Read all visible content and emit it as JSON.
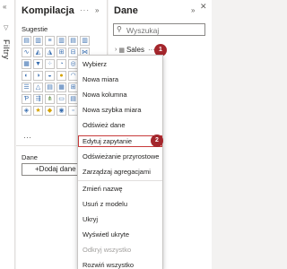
{
  "filters": {
    "label": "Filtry",
    "collapse_glyph": "«",
    "funnel_glyph": "▽"
  },
  "build_pane": {
    "title": "Kompilacja",
    "more_glyph": "···",
    "expand_glyph": "»",
    "suggestions_label": "Sugestie",
    "more_visuals": "···",
    "data_section_label": "Dane",
    "add_data_label": "+Dodaj dane"
  },
  "data_pane": {
    "title": "Dane",
    "expand_glyph": "»",
    "close_glyph": "✕",
    "search_placeholder": "Wyszukaj",
    "table_name": "Sales",
    "table_more": "···"
  },
  "context_menu": {
    "items": [
      {
        "label": "Wybierz",
        "disabled": false
      },
      {
        "label": "Nowa miara",
        "disabled": false
      },
      {
        "label": "Nowa kolumna",
        "disabled": false
      },
      {
        "label": "Nowa szybka miara",
        "disabled": false
      },
      {
        "label": "Odśwież dane",
        "disabled": false
      },
      {
        "label": "Edytuj zapytanie",
        "disabled": false
      },
      {
        "label": "Odświeżanie przyrostowe",
        "disabled": false
      },
      {
        "label": "Zarządzaj agregacjami",
        "disabled": false
      },
      {
        "label": "Zmień nazwę",
        "disabled": false
      },
      {
        "label": "Usuń z modelu",
        "disabled": false
      },
      {
        "label": "Ukryj",
        "disabled": false
      },
      {
        "label": "Wyświetl ukryte",
        "disabled": false
      },
      {
        "label": "Odkryj wszystko",
        "disabled": true
      },
      {
        "label": "Zwiń wszystko",
        "disabled": false
      },
      {
        "label": "Rozwiń wszystko",
        "disabled": false
      }
    ]
  },
  "badges": {
    "step1": "1",
    "step2": "2"
  },
  "colors": {
    "badge": "#a4262c",
    "highlight_border": "#c73b3b",
    "accent": "#3a6fb0"
  }
}
